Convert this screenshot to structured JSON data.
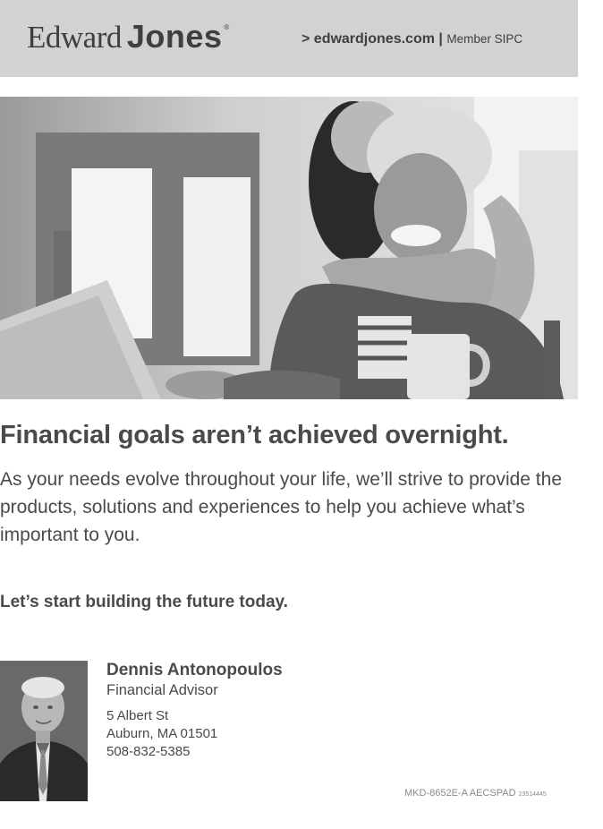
{
  "header": {
    "logo_word1": "Edward",
    "logo_word2": "Jones",
    "logo_mark": "®",
    "website": "> edwardjones.com",
    "separator": "|",
    "member": "Member SIPC"
  },
  "photo": {
    "subject": "family-hug-photo"
  },
  "main": {
    "headline": "Financial goals aren’t achieved overnight.",
    "body": "As your needs evolve throughout your life, we’ll strive to provide the products, solutions and experiences to help you achieve what’s important to you.",
    "cta": "Let’s start building the future today."
  },
  "advisor": {
    "name": "Dennis Antonopoulos",
    "title": "Financial Advisor",
    "address_line1": "5 Albert St",
    "address_line2": "Auburn, MA 01501",
    "phone": "508-832-5385"
  },
  "footer": {
    "code": "MKD-8652E-A AECSPAD",
    "code_small": "23514445"
  }
}
